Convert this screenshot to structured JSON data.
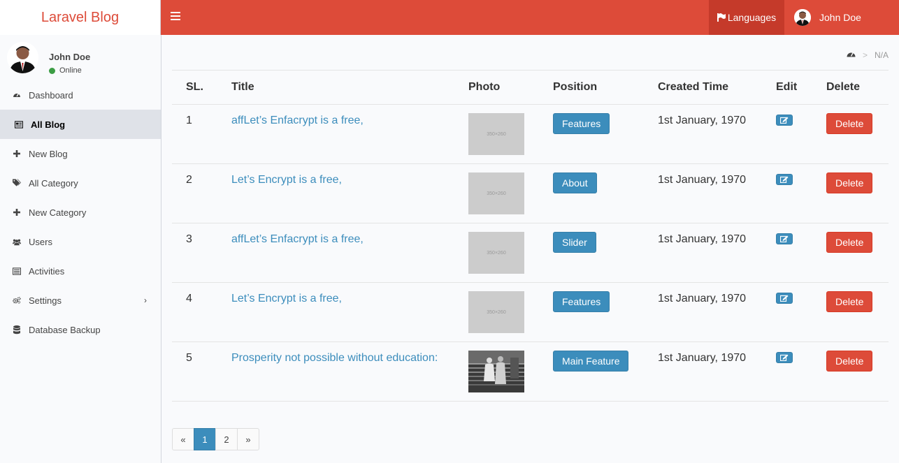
{
  "app": {
    "logo": "Laravel Blog"
  },
  "topbar": {
    "languages_label": "Languages",
    "user_name": "John Doe"
  },
  "sidebar": {
    "user": {
      "name": "John Doe",
      "status": "Online"
    },
    "items": [
      {
        "label": "Dashboard",
        "icon": "dashboard-icon"
      },
      {
        "label": "All Blog",
        "icon": "newspaper-icon"
      },
      {
        "label": "New Blog",
        "icon": "plus-icon"
      },
      {
        "label": "All Category",
        "icon": "tags-icon"
      },
      {
        "label": "New Category",
        "icon": "plus-icon"
      },
      {
        "label": "Users",
        "icon": "users-icon"
      },
      {
        "label": "Activities",
        "icon": "list-icon"
      },
      {
        "label": "Settings",
        "icon": "gears-icon"
      },
      {
        "label": "Database Backup",
        "icon": "database-icon"
      }
    ]
  },
  "breadcrumb": {
    "current": "N/A"
  },
  "table": {
    "headers": [
      "SL.",
      "Title",
      "Photo",
      "Position",
      "Created Time",
      "Edit",
      "Delete"
    ],
    "rows": [
      {
        "sl": "1",
        "title": "affLet’s Enfacrypt is a free,",
        "photo": "350×260",
        "position": "Features",
        "created": "1st January, 1970",
        "delete": "Delete"
      },
      {
        "sl": "2",
        "title": "Let’s Encrypt is a free,",
        "photo": "350×260",
        "position": "About",
        "created": "1st January, 1970",
        "delete": "Delete"
      },
      {
        "sl": "3",
        "title": "affLet’s Enfacrypt is a free,",
        "photo": "350×260",
        "position": "Slider",
        "created": "1st January, 1970",
        "delete": "Delete"
      },
      {
        "sl": "4",
        "title": "Let’s Encrypt is a free,",
        "photo": "350×260",
        "position": "Features",
        "created": "1st January, 1970",
        "delete": "Delete"
      },
      {
        "sl": "5",
        "title": "Prosperity not possible without education:",
        "photo": "",
        "position": "Main Feature",
        "created": "1st January, 1970",
        "delete": "Delete"
      }
    ]
  },
  "pagination": {
    "prev": "«",
    "pages": [
      "1",
      "2"
    ],
    "next": "»",
    "active": "1"
  },
  "colors": {
    "brand": "#dd4b39",
    "primary": "#3c8dbc"
  }
}
